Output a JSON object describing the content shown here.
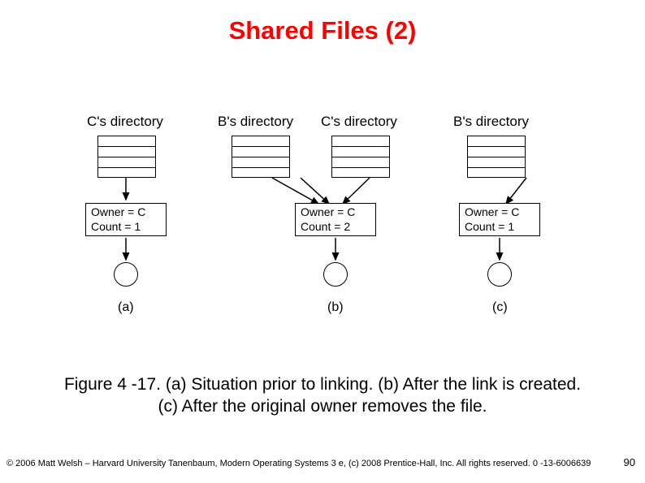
{
  "title": "Shared Files (2)",
  "labels": {
    "c_dir": "C's directory",
    "b_dir": "B's directory"
  },
  "info": {
    "a_line1": "Owner = C",
    "a_line2": "Count = 1",
    "b_line1": "Owner = C",
    "b_line2": "Count = 2",
    "c_line1": "Owner = C",
    "c_line2": "Count = 1"
  },
  "sub": {
    "a": "(a)",
    "b": "(b)",
    "c": "(c)"
  },
  "caption_line1": "Figure 4 -17. (a) Situation prior to linking. (b) After the link is created.",
  "caption_line2": "(c) After the original owner removes the file.",
  "footer_left": "© 2006 Matt Welsh – Harvard University Tanenbaum, Modern Operating Systems 3 e, (c) 2008 Prentice-Hall, Inc. All rights reserved. 0 -13-6006639",
  "page_number": "90"
}
